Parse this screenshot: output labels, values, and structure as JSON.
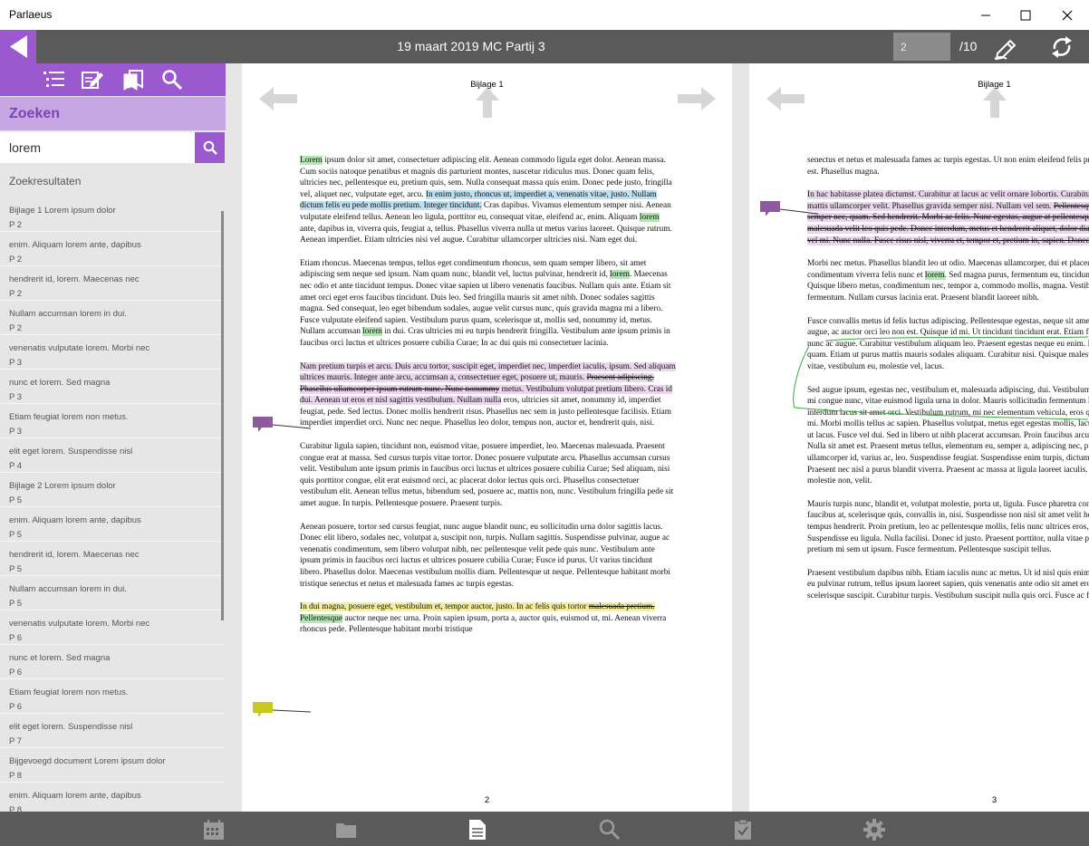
{
  "window": {
    "title": "Parlaeus",
    "minimize": "—",
    "maximize": "☐",
    "close": "✕"
  },
  "toolbar": {
    "document_title": "19 maart 2019 MC Partij 3",
    "page_input": "2",
    "page_total": "/10",
    "icons": [
      "back-arrow-icon",
      "pen-annotate-icon",
      "sync-icon"
    ]
  },
  "sidebar": {
    "tabs": [
      "list-icon",
      "edit-icon",
      "bookmarks-icon",
      "search-icon"
    ],
    "heading": "Zoeken",
    "search_value": "lorem",
    "results_label": "Zoekresultaten",
    "results": [
      {
        "text": "Bijlage 1 Lorem ipsum dolor",
        "page": "P 2"
      },
      {
        "text": "enim. Aliquam lorem ante, dapibus",
        "page": "P 2"
      },
      {
        "text": "hendrerit id, lorem. Maecenas nec",
        "page": "P 2"
      },
      {
        "text": "Nullam accumsan lorem in dui.",
        "page": "P 2"
      },
      {
        "text": "venenatis vulputate lorem. Morbi nec",
        "page": "P 3"
      },
      {
        "text": "nunc et lorem. Sed magna",
        "page": "P 3"
      },
      {
        "text": "Etiam feugiat lorem non metus.",
        "page": "P 3"
      },
      {
        "text": "elit eget lorem. Suspendisse nisl",
        "page": "P 4"
      },
      {
        "text": "Bijlage 2 Lorem ipsum dolor",
        "page": "P 5"
      },
      {
        "text": "enim. Aliquam lorem ante, dapibus",
        "page": "P 5"
      },
      {
        "text": "hendrerit id, lorem. Maecenas nec",
        "page": "P 5"
      },
      {
        "text": "Nullam accumsan lorem in dui.",
        "page": "P 5"
      },
      {
        "text": "venenatis vulputate lorem. Morbi nec",
        "page": "P 6"
      },
      {
        "text": "nunc et lorem. Sed magna",
        "page": "P 6"
      },
      {
        "text": "Etiam feugiat lorem non metus.",
        "page": "P 6"
      },
      {
        "text": "elit eget lorem. Suspendisse nisl",
        "page": "P 7"
      },
      {
        "text": "Bijgevoegd document Lorem ipsum dolor",
        "page": "P 8"
      },
      {
        "text": "enim. Aliquam lorem ante, dapibus",
        "page": "P 8"
      }
    ]
  },
  "pages": {
    "left": {
      "label": "Bijlage 1",
      "number": "2",
      "p1a": "Lorem",
      "p1b": " ipsum dolor sit amet, consectetuer adipiscing elit. Aenean commodo ligula eget dolor. Aenean massa. Cum sociis natoque penatibus et magnis dis parturient montes, nascetur ridiculus mus. Donec quam felis, ultricies nec, pellentesque eu, pretium quis, sem. Nulla consequat massa quis enim. Donec pede justo, fringilla vel, aliquet nec, vulputate eget, arcu. ",
      "p1c": "In enim justo, rhoncus ut, imperdiet a, venenatis vitae, justo. Nullam dictum felis eu pede mollis pretium. Integer tincidunt.",
      "p1d": " Cras dapibus. Vivamus elementum semper nisi. Aenean vulputate eleifend tellus. Aenean leo ligula, porttitor eu, consequat vitae, eleifend ac, enim. Aliquam ",
      "p1e": "lorem",
      "p1f": " ante, dapibus in, viverra quis, feugiat a, tellus. Phasellus viverra nulla ut metus varius laoreet. Quisque rutrum. Aenean imperdiet. Etiam ultricies nisi vel augue. Curabitur ullamcorper ultricies nisi. Nam eget dui.",
      "p2a": "Etiam rhoncus. Maecenas tempus, tellus eget condimentum rhoncus, sem quam semper libero, sit amet adipiscing sem neque sed ipsum. Nam quam nunc, blandit vel, luctus pulvinar, hendrerit id, ",
      "p2b": "lorem",
      "p2c": ". Maecenas nec odio et ante tincidunt tempus. Donec vitae sapien ut libero venenatis faucibus. Nullam quis ante. Etiam sit amet orci eget eros faucibus tincidunt. Duis leo. Sed fringilla mauris sit amet nibh. Donec sodales sagittis magna. Sed consequat, leo eget bibendum sodales, augue velit cursus nunc, quis gravida magna mi a libero. Fusce vulputate eleifend sapien. Vestibulum purus quam, scelerisque ut, mollis sed, nonummy id, metus. Nullam accumsan ",
      "p2d": "lorem",
      "p2e": " in dui. Cras ultricies mi eu turpis hendrerit fringilla. Vestibulum ante ipsum primis in faucibus orci luctus et ultrices posuere cubilia Curae; In ac dui quis mi consectetuer lacinia.",
      "p3a": "Nam pretium turpis et arcu. Duis arcu tortor, suscipit eget, imperdiet nec, imperdiet iaculis, ipsum. Sed aliquam ultrices mauris. Integer ante arcu, accumsan a, consectetuer eget, posuere ut, mauris. ",
      "p3b": "Praesent adipiscing. Phasellus ullamcorper ipsum rutrum nunc. Nunc nonummy",
      "p3c": " metus. Vestibulum volutpat pretium libero. Cras id dui. Aenean ut eros et nisl sagittis vestibulum. Nullam nulla",
      "p3d": " eros, ultricies sit amet, nonummy id, imperdiet feugiat, pede. Sed lectus. Donec mollis hendrerit risus. Phasellus nec sem in justo pellentesque facilisis. Etiam imperdiet imperdiet orci. Nunc nec neque. Phasellus leo dolor, tempus non, auctor et, hendrerit quis, nisi.",
      "p4": "Curabitur ligula sapien, tincidunt non, euismod vitae, posuere imperdiet, leo. Maecenas malesuada. Praesent congue erat at massa. Sed cursus turpis vitae tortor. Donec posuere vulputate arcu. Phasellus accumsan cursus velit. Vestibulum ante ipsum primis in faucibus orci luctus et ultrices posuere cubilia Curae; Sed aliquam, nisi quis porttitor congue, elit erat euismod orci, ac placerat dolor lectus quis orci. Phasellus consectetuer vestibulum elit. Aenean tellus metus, bibendum sed, posuere ac, mattis non, nunc. Vestibulum fringilla pede sit amet augue. In turpis. Pellentesque posuere. Praesent turpis.",
      "p5": "Aenean posuere, tortor sed cursus feugiat, nunc augue blandit nunc, eu sollicitudin urna dolor sagittis lacus. Donec elit libero, sodales nec, volutpat a, suscipit non, turpis. Nullam sagittis. Suspendisse pulvinar, augue ac venenatis condimentum, sem libero volutpat nibh, nec pellentesque velit pede quis nunc. Vestibulum ante ipsum primis in faucibus orci luctus et ultrices posuere cubilia Curae; Fusce id purus. Ut varius tincidunt libero. Phasellus dolor. Maecenas vestibulum mollis diam. Pellentesque ut neque. Pellentesque habitant morbi tristique senectus et netus et malesuada fames ac turpis egestas.",
      "p6a": "In dui magna, posuere eget, vestibulum et, tempor auctor, justo. In ac felis quis tortor ",
      "p6b": "malesuada pretium.",
      "p6c": " Pellentesque",
      "p6d": " auctor neque nec urna. Proin sapien ipsum, porta a, auctor quis, euismod ut, mi. Aenean viverra rhoncus pede. Pellentesque habitant morbi tristique"
    },
    "right": {
      "label": "Bijlage 1",
      "number": "3",
      "p1": "senectus et netus et malesuada fames ac turpis egestas. Ut non enim eleifend felis pretium feugiat. Vivamus quis mi. Phasellus a est. Phasellus magna.",
      "p2a": "In hac habitasse platea dictumst. Curabitur at lacus ac velit ornare lobortis. Curabitur a felis in nunc fringilla tristique. Morbi mattis ullamcorper velit. Phasellus gravida semper nisi. Nullam vel sem. ",
      "p2b": "Pellentesque libero tortor, tincidunt et, tincidunt eget, semper nec, quam. Sed hendrerit. Morbi ac felis. Nunc egestas, augue at pellentesque laoreet, felis eros vehicula leo, at malesuada velit leo quis pede. Donec interdum, metus et hendrerit aliquet, dolor diam sagittis ligula, eget egestas libero turpis vel mi. Nunc nulla. Fusce risus nisl, viverra et, tempor et, pretium in, sapien. Donec venenatis vulputate ",
      "p2c": "lorem",
      "p2d": ".",
      "p3a": "Morbi nec metus. Phasellus blandit leo ut odio. Maecenas ullamcorper, dui et placerat feugiat, eros pede varius nisi, condimentum viverra felis nunc et ",
      "p3b": "lorem",
      "p3c": ". Sed magna purus, fermentum eu, tincidunt eu, varius ut, felis. In auctor lobortis lacus. Quisque libero metus, condimentum nec, tempor a, commodo mollis, magna. Vestibulum ullamcorper mauris at ligula. Fusce fermentum. Nullam cursus lacinia erat. Praesent blandit laoreet nibh.",
      "p4a": "Fusce convallis metus id felis luctus adipiscing. Pellentesque egestas, neque sit amet convallis pulvinar, justo nulla eleifend augue, ac auctor orci leo non est. Quisque id mi. Ut tincidunt tincidunt erat. Etiam feugiat ",
      "p4b": "lorem",
      "p4c": " non metus. Vestibulum dapibus nunc ac augue. Curabitur vestibulum aliquam leo. Praesent egestas neque eu enim. In hac habitasse platea dictumst. Fusce a quam. Etiam ut purus mattis mauris sodales aliquam. Curabitur nisi. Quisque malesuada placerat nisl. Nam ipsum risus, rutrum vitae, vestibulum eu, molestie vel, lacus.",
      "p5": "Sed augue ipsum, egestas nec, vestibulum et, malesuada adipiscing, dui. Vestibulum facilisis, purus nec pulvinar iaculis, ligula mi congue nunc, vitae euismod ligula urna in dolor. Mauris sollicitudin fermentum libero. Praesent nonummy mi in odio. Nunc interdum lacus sit amet orci. Vestibulum rutrum, mi nec elementum vehicula, eros quam gravida nisl, id fringilla neque ante vel mi. Morbi mollis tellus ac sapien. Phasellus volutpat, metus eget egestas mollis, lacus lacus blandit dui, id egestas quam mauris ut lacus. Fusce vel dui. Sed in libero ut nibh placerat accumsan. Proin faucibus arcu quis ante. In consectetuer turpis ut velit. Nulla sit amet est. Praesent metus tellus, elementum eu, semper a, adipiscing nec, purus. Cras risus ipsum, faucibus ut, ullamcorper id, varius ac, leo. Suspendisse feugiat. Suspendisse enim turpis, dictum sed, iaculis a, condimentum nec, nisi. Praesent nec nisl a purus blandit viverra. Praesent ac massa at ligula laoreet iaculis. Nulla neque dolor, sagittis eget, iaculis quis, molestie non, velit.",
      "p6": "Mauris turpis nunc, blandit et, volutpat molestie, porta ut, ligula. Fusce pharetra convallis urna. Quisque ut nisi. Donec mi odio, faucibus at, scelerisque quis, convallis in, nisi. Suspendisse non nisl sit amet velit hendrerit rutrum. Ut leo. Ut a nisl id ante tempus hendrerit. Proin pretium, leo ac pellentesque mollis, felis nunc ultrices eros, sed gravida augue augue mollis justo. Suspendisse eu ligula. Nulla facilisi. Donec id justo. Praesent porttitor, nulla vitae posuere iaculis, arcu nisl dignissim dolor, a pretium mi sem ut ipsum. Fusce fermentum. Pellentesque suscipit tellus.",
      "p7": "Praesent vestibulum dapibus nibh. Etiam iaculis nunc ac metus. Ut id nisl quis enim dignissim sagittis. Etiam sollicitudin, ipsum eu pulvinar rutrum, tellus ipsum laoreet sapien, quis venenatis ante odio sit amet eros. Proin magna. Duis vel nibh at velit scelerisque suscipit. Curabitur turpis. Vestibulum suscipit nulla quis orci. Fusce ac felis sit amet ligula pharetra"
    }
  },
  "colors": {
    "accent": "#9b59d0",
    "accent_light": "#c7a6e4",
    "bar": "#5a5a5a",
    "note_purple": "#8e5a9e",
    "note_yellow": "#c8c820",
    "ink_green": "#3aa83a"
  },
  "bottom_nav": [
    "calendar-icon",
    "folder-icon",
    "document-icon",
    "search-icon",
    "clipboard-check-icon",
    "settings-gear-icon"
  ]
}
